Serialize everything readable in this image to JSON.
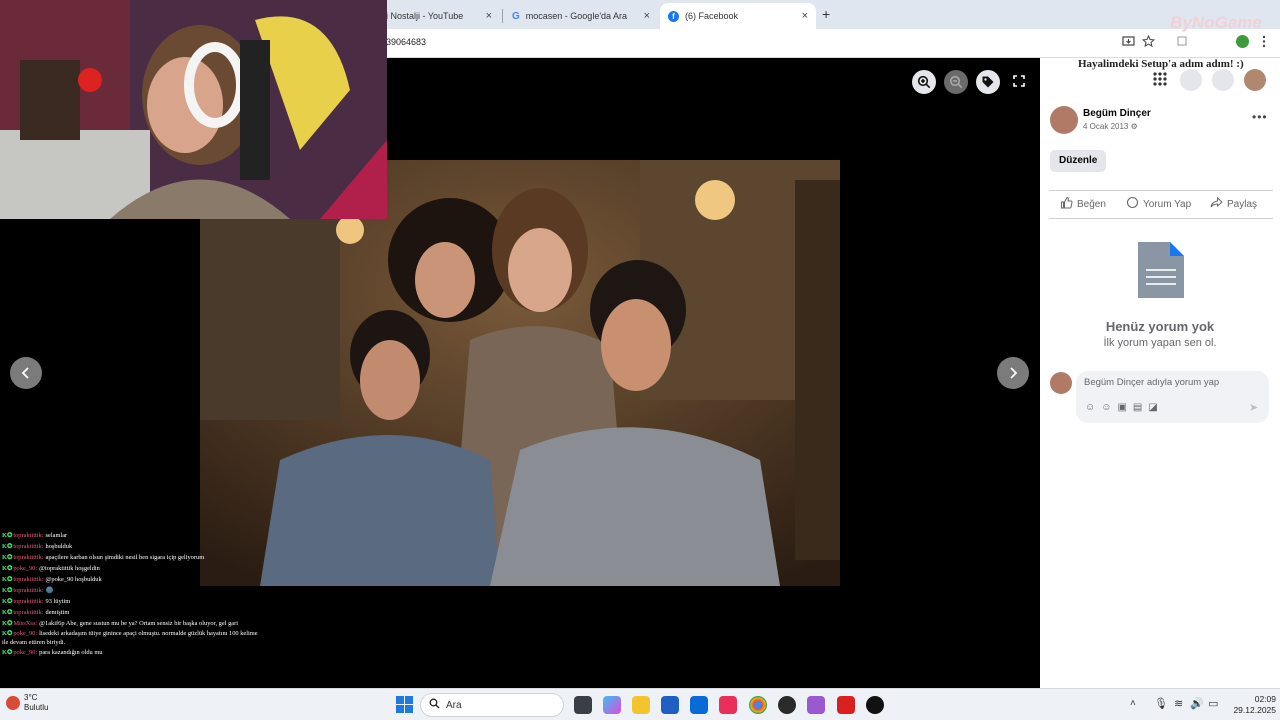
{
  "browser": {
    "tabs": [
      {
        "title": "i Nostalji - YouTube",
        "active": false
      },
      {
        "title": "mocasen - Google'da Ara",
        "active": false
      },
      {
        "title": "(6) Facebook",
        "active": true
      }
    ],
    "new_tab_label": "+",
    "close_glyph": "×",
    "url": "39064683"
  },
  "viewer": {
    "header_overlay_text": "Hayalimdeki Setup'a adım adım! :)"
  },
  "post": {
    "author": "Begüm Dinçer",
    "date": "4 Ocak 2013",
    "edit_label": "Düzenle",
    "actions": {
      "like": "Beğen",
      "comment": "Yorum Yap",
      "share": "Paylaş"
    },
    "empty_title": "Henüz yorum yok",
    "empty_subtitle": "İlk yorum yapan sen ol.",
    "comment_placeholder": "Begüm Dinçer adıyla yorum yap"
  },
  "stream": {
    "brand": "ByNoGame",
    "chat": [
      {
        "user": "topraktittik:",
        "text": "selamlar"
      },
      {
        "user": "topraktittik:",
        "text": "hoşbulduk"
      },
      {
        "user": "topraktittik:",
        "text": "apaçilere karban olsun şimdiki nesil ben sigara içip geliyorum"
      },
      {
        "user": "poke_90:",
        "text": "@topraktittik hoşgeldin"
      },
      {
        "user": "topraktittik:",
        "text": "@poke_90 hoşbulduk"
      },
      {
        "user": "topraktittik:",
        "text": "🌚"
      },
      {
        "user": "topraktittik:",
        "text": "93 lüytim"
      },
      {
        "user": "topraktittik:",
        "text": "demiştim"
      },
      {
        "user": "MissXss:",
        "text": "@1akif6p Abe, gene sustun mu be ya? Ortam sensiz bir başka oluyor, gel gari"
      },
      {
        "user": "poke_90:",
        "text": "lisedeki arkadaşım tüiye ginince apaçi olmuştu. normalde güzlük hayatını 100 kelime ile devam ettiren biriydi."
      },
      {
        "user": "poke_90:",
        "text": "para kazandığın oldu mu"
      }
    ]
  },
  "taskbar": {
    "search_label": "Ara",
    "weather_temp": "3°C",
    "weather_desc": "Bulutlu",
    "time": "02:09",
    "date": "29.12.2025"
  },
  "colors": {
    "fb_blue": "#1877f2",
    "tab_strip": "#dfe6ef",
    "viewer_bg": "#000000",
    "chat_badge": "#3ce06a",
    "chat_user": "#e85a7a"
  }
}
